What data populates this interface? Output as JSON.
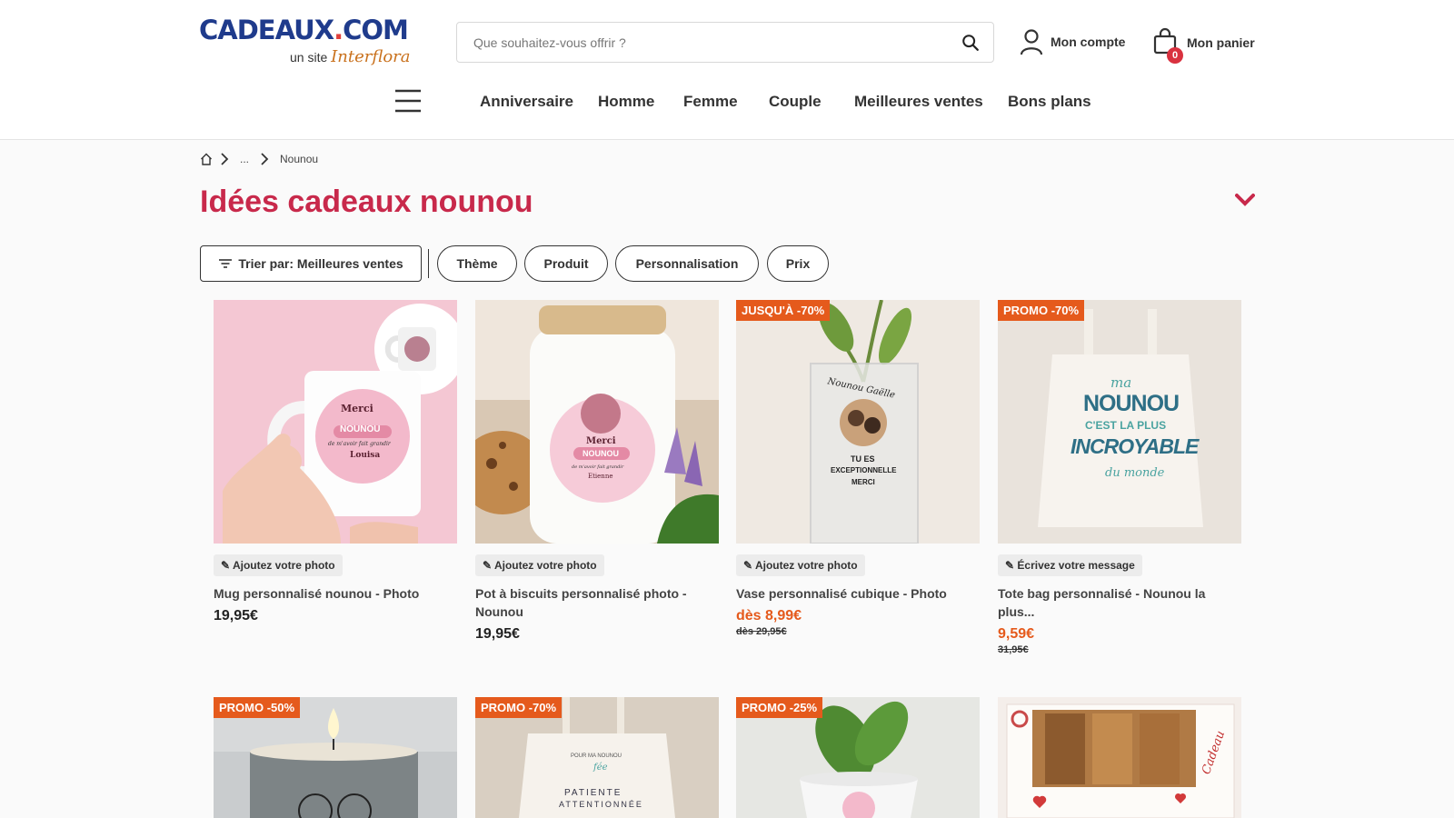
{
  "header": {
    "logo_main_left": "CADEAUX",
    "logo_dot": ".",
    "logo_main_right": "COM",
    "logo_sub_prefix": "un site ",
    "logo_sub_brand": "Interflora",
    "search_placeholder": "Que souhaitez-vous offrir ?",
    "account_label": "Mon compte",
    "cart_label": "Mon panier",
    "cart_count": "0"
  },
  "nav": {
    "items": [
      "Anniversaire",
      "Homme",
      "Femme",
      "Couple",
      "Meilleures ventes",
      "Bons plans"
    ]
  },
  "breadcrumb": {
    "ellipsis": "...",
    "current": "Nounou"
  },
  "page": {
    "title": "Idées cadeaux nounou"
  },
  "filters": {
    "sort_label": "Trier par: Meilleures ventes",
    "chips": [
      "Thème",
      "Produit",
      "Personnalisation",
      "Prix"
    ]
  },
  "products": [
    {
      "badge": "",
      "tag": "✎ Ajoutez votre photo",
      "name": "Mug personnalisé nounou - Photo",
      "price": "19,95€",
      "old_price": ""
    },
    {
      "badge": "",
      "tag": "✎ Ajoutez votre photo",
      "name": "Pot à biscuits personnalisé photo - Nounou",
      "price": "19,95€",
      "old_price": ""
    },
    {
      "badge": "JUSQU'À -70%",
      "tag": "✎ Ajoutez votre photo",
      "name": "Vase personnalisé cubique - Photo",
      "price": "dès 8,99€",
      "old_price": "dès 29,95€"
    },
    {
      "badge": "PROMO -70%",
      "tag": "✎ Écrivez votre message",
      "name": "Tote bag personnalisé - Nounou la plus...",
      "price": "9,59€",
      "old_price": "31,95€"
    },
    {
      "badge": "PROMO -50%"
    },
    {
      "badge": "PROMO -70%"
    },
    {
      "badge": "PROMO -25%"
    },
    {
      "badge": ""
    }
  ],
  "image_text": {
    "mug_line1": "Merci",
    "mug_line2": "NOUNOU",
    "mug_line3": "de m'avoir fait grandir",
    "mug_line4": "Louisa",
    "jar_line1": "Merci",
    "jar_line2": "NOUNOU",
    "jar_line3": "de m'avoir fait grandir",
    "jar_line4": "Etienne",
    "vase_line1": "Nounou Gaëlle",
    "vase_line2": "TU ES",
    "vase_line3": "EXCEPTIONNELLE",
    "vase_line4": "MERCI",
    "tote_line1": "ma",
    "tote_line2": "NOUNOU",
    "tote_line3": "C'EST LA PLUS",
    "tote_line4": "INCROYABLE",
    "tote_line5": "du monde",
    "bag2_line1": "POUR MA NOUNOU",
    "bag2_line2": "fée",
    "bag2_line3": "PATIENTE",
    "bag2_line4": "ATTENTIONNÉE",
    "cookie_box": "Cadeau"
  },
  "colors": {
    "brand_blue": "#1f3b8c",
    "brand_red": "#e0403c",
    "title_red": "#c8294b",
    "promo_orange": "#e55a1c",
    "badge_red": "#d9313f"
  }
}
